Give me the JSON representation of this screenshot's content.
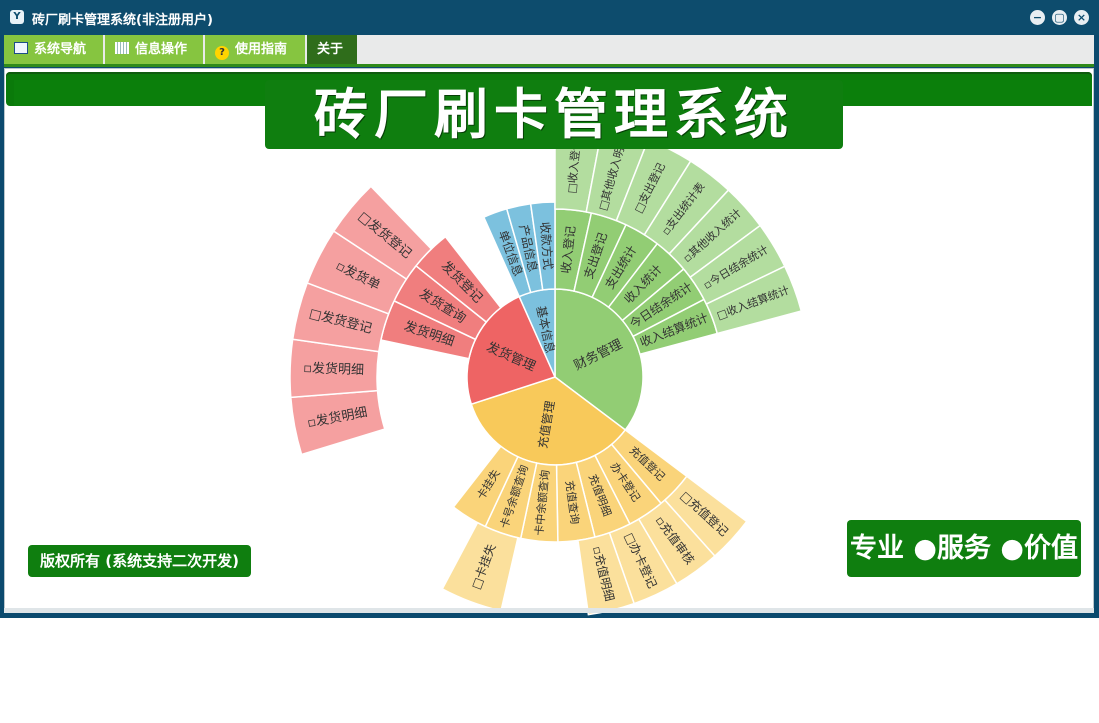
{
  "window": {
    "title": "砖厂刷卡管理系统(非注册用户)",
    "controls": [
      "minimize",
      "restore",
      "close"
    ]
  },
  "tabs": [
    {
      "label": "系统导航",
      "icon": "monitor-icon"
    },
    {
      "label": "信息操作",
      "icon": "grid-icon"
    },
    {
      "label": "使用指南",
      "icon": "help-icon"
    },
    {
      "label": "关于",
      "icon": ""
    }
  ],
  "banner": {
    "title": "砖厂刷卡管理系统"
  },
  "footer": {
    "copyright": "版权所有 (系统支持二次开发)",
    "slogan": "专业 ●服务 ●价值"
  },
  "sunburst": {
    "colors": {
      "finance": "#92cd74",
      "finance_outer": "#b3dd9f",
      "basic": "#7cc1de",
      "delivery": "#ee6464",
      "delivery_mid": "#f07e7e",
      "delivery_outer": "#f5a0a0",
      "recharge": "#f8c95a",
      "recharge_mid": "#fad47a",
      "recharge_outer": "#fbe09c"
    },
    "inner": {
      "finance": "财务管理",
      "basic": "基本信息",
      "delivery": "发货管理",
      "recharge": "充值管理"
    },
    "middle": {
      "finance": [
        "收入登记",
        "支出登记",
        "支出统计",
        "收入统计",
        "今日结余统计",
        "收入结算统计"
      ],
      "basic": [
        "单位信息",
        "产品信息",
        "收款方式"
      ],
      "delivery": [
        "发货明细",
        "发货查询",
        "发货登记"
      ],
      "recharge": [
        "充值登记",
        "办卡登记",
        "充值明细",
        "充值查询",
        "卡中余额查询",
        "卡号余额查询",
        "卡挂失"
      ]
    },
    "outer": {
      "finance": [
        "□收入登记",
        "□其他收入明细",
        "□支出登记",
        "▫支出统计表",
        "▫其他收入统计",
        "▫今日结余统计",
        "□收入结算统计"
      ],
      "delivery": [
        "▫发货明细",
        "▫发货明细",
        "□发货登记",
        "▫发货单",
        "□发货登记"
      ],
      "recharge": [
        "□充值登记",
        "▫充值审核",
        "□办卡登记",
        "▫充值明细",
        "□卡挂失"
      ]
    }
  }
}
